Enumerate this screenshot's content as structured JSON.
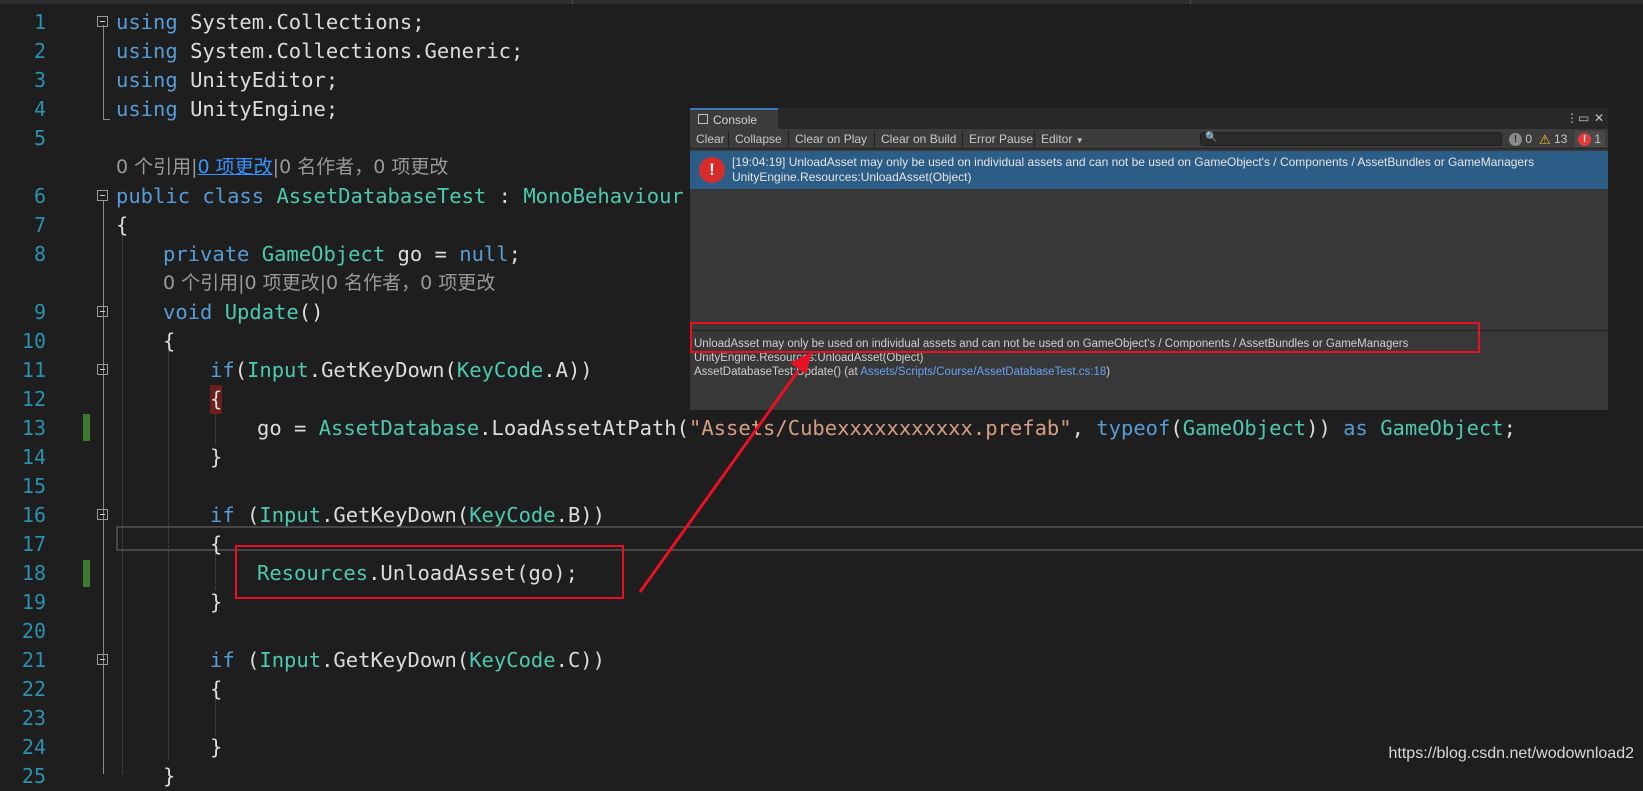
{
  "editor": {
    "lines": [
      {
        "num": "1",
        "parts": [
          [
            "kw",
            "using"
          ],
          [
            "",
            "System.Collections;"
          ]
        ],
        "fold": true
      },
      {
        "num": "2",
        "parts": [
          [
            "kw",
            "using"
          ],
          [
            "",
            "System.Collections.Generic;"
          ]
        ]
      },
      {
        "num": "3",
        "parts": [
          [
            "kw",
            "using"
          ],
          [
            "",
            "UnityEditor;"
          ]
        ]
      },
      {
        "num": "4",
        "parts": [
          [
            "kw",
            "using"
          ],
          [
            "",
            "UnityEngine;"
          ]
        ]
      },
      {
        "num": "5",
        "parts": []
      },
      {
        "num": "",
        "hint": true
      },
      {
        "num": "6",
        "parts": [
          [
            "kw",
            "public class"
          ],
          [
            "ty",
            "AssetDatabaseTest"
          ],
          [
            "",
            " : "
          ],
          [
            "ty",
            "MonoBehaviour"
          ]
        ],
        "fold": true
      },
      {
        "num": "7",
        "parts": [
          [
            "",
            "{"
          ]
        ]
      },
      {
        "num": "8",
        "parts": [
          [
            "kw",
            "private"
          ],
          [
            "ty",
            "GameObject"
          ],
          [
            "",
            "go = "
          ],
          [
            "kw",
            "null"
          ],
          [
            "",
            ";"
          ]
        ]
      },
      {
        "num": "",
        "hint2": true
      },
      {
        "num": "9",
        "parts": [
          [
            "kw",
            "void"
          ],
          [
            "",
            "Update()"
          ]
        ],
        "fold": true
      },
      {
        "num": "10",
        "parts": [
          [
            "",
            "{"
          ]
        ]
      },
      {
        "num": "11",
        "parts": [
          [
            "kw",
            "if"
          ],
          [
            "",
            "(Input.GetKeyDown(KeyCode.A))"
          ]
        ],
        "fold": true
      },
      {
        "num": "12",
        "parts": [
          [
            "",
            "{"
          ]
        ]
      },
      {
        "num": "13",
        "parts": [
          [
            "",
            "go = AssetDatabase.LoadAssetAtPath("
          ],
          [
            "st",
            "\"Assets/Cubexxxxxxxxxxx.prefab\""
          ],
          [
            "",
            ", "
          ],
          [
            "kw",
            "typeof"
          ],
          [
            "",
            "(GameObject))"
          ],
          [
            "kw",
            "as"
          ],
          [
            "ty",
            "GameObject"
          ],
          [
            "",
            ";"
          ]
        ]
      },
      {
        "num": "14",
        "parts": [
          [
            "",
            "}"
          ]
        ]
      },
      {
        "num": "15",
        "parts": []
      },
      {
        "num": "16",
        "parts": [
          [
            "kw",
            "if"
          ],
          [
            "",
            "(Input.GetKeyDown(KeyCode.B))"
          ]
        ],
        "fold": true
      },
      {
        "num": "17",
        "parts": [
          [
            "",
            "{"
          ]
        ]
      },
      {
        "num": "18",
        "parts": [
          [
            "ty",
            "Resources"
          ],
          [
            "",
            ".UnloadAsset(go);"
          ]
        ]
      },
      {
        "num": "19",
        "parts": [
          [
            "",
            "}"
          ]
        ]
      },
      {
        "num": "20",
        "parts": []
      },
      {
        "num": "21",
        "parts": [
          [
            "kw",
            "if"
          ],
          [
            "",
            "(Input.GetKeyDown(KeyCode.C))"
          ]
        ],
        "fold": true
      },
      {
        "num": "22",
        "parts": [
          [
            "",
            "{"
          ]
        ]
      },
      {
        "num": "23",
        "parts": []
      },
      {
        "num": "24",
        "parts": [
          [
            "",
            "}"
          ]
        ]
      },
      {
        "num": "25",
        "parts": [
          [
            "",
            "}"
          ]
        ]
      }
    ],
    "line_numbers": [
      "1",
      "2",
      "3",
      "4",
      "5",
      "6",
      "7",
      "8",
      "9",
      "10",
      "11",
      "12",
      "13",
      "14",
      "15",
      "16",
      "17",
      "18",
      "19",
      "20",
      "21",
      "22",
      "23",
      "24",
      "25"
    ],
    "hint_refs": "0 个引用|",
    "hint_changes_link": "0 项更改",
    "hint_authors": "|0 名作者，0 项更改",
    "hint2_text": "0 个引用|0 项更改|0 名作者，0 项更改",
    "code": {
      "l1_kw": "using",
      "l1_txt": "System.Collections;",
      "l2_kw": "using",
      "l2_txt": "System.Collections.Generic;",
      "l3_kw": "using",
      "l3_txt": "UnityEditor;",
      "l4_kw": "using",
      "l4_txt": "UnityEngine;",
      "l6_kw": "public class",
      "l6_name": "AssetDatabaseTest",
      "l6_colon": " : ",
      "l6_base": "MonoBehaviour",
      "brace_open": "{",
      "brace_close": "}",
      "l8_kw": "private",
      "l8_type": "GameObject",
      "l8_txt": "go = ",
      "l8_null": "null",
      "semi": ";",
      "l9_kw": "void",
      "l9_name": "Update",
      "l9_paren": "()",
      "if_kw": "if",
      "l11_a": "(",
      "input": "Input",
      "getkeydown": ".GetKeyDown(",
      "keycode": "KeyCode",
      "l11_b": ".A))",
      "l13_a": "go = ",
      "assetdatabase": "AssetDatabase",
      "l13_b": ".LoadAssetAtPath(",
      "l13_str": "\"Assets/Cubexxxxxxxxxxx.prefab\"",
      "l13_c": ", ",
      "typeof_kw": "typeof",
      "l13_d": "(",
      "gameobject": "GameObject",
      "l13_e": ")) ",
      "as_kw": "as",
      "l13_f": ";",
      "l16_a": " (",
      "l16_b": ".B))",
      "resources": "Resources",
      "l18_b": ".UnloadAsset(go);",
      "l21_b": ".C))"
    }
  },
  "console": {
    "tab_label": "Console",
    "toolbar": {
      "clear": "Clear",
      "collapse": "Collapse",
      "clear_on_play": "Clear on Play",
      "clear_on_build": "Clear on Build",
      "error_pause": "Error Pause",
      "editor": "Editor",
      "search_value": ""
    },
    "counts": {
      "info": "0",
      "warn": "13",
      "error": "1"
    },
    "log": {
      "line1": "[19:04:19] UnloadAsset may only be used on individual assets and can not be used on GameObject's / Components / AssetBundles or GameManagers",
      "line2": "UnityEngine.Resources:UnloadAsset(Object)"
    },
    "detail": {
      "line1": "UnloadAsset may only be used on individual assets and can not be used on GameObject's / Components / AssetBundles or GameManagers",
      "line2": "UnityEngine.Resources:UnloadAsset(Object)",
      "line3_a": "AssetDatabaseTest:Update() (at ",
      "line3_link": "Assets/Scripts/Course/AssetDatabaseTest.cs:18",
      "line3_b": ")"
    }
  },
  "watermark": "https://blog.csdn.net/wodownload2",
  "colors": {
    "keyword": "#569cd6",
    "type": "#4ec9b0",
    "string": "#d69d85",
    "line_number": "#2b91af",
    "highlight_box": "#e81123",
    "console_selected_row": "#2c5d87"
  }
}
